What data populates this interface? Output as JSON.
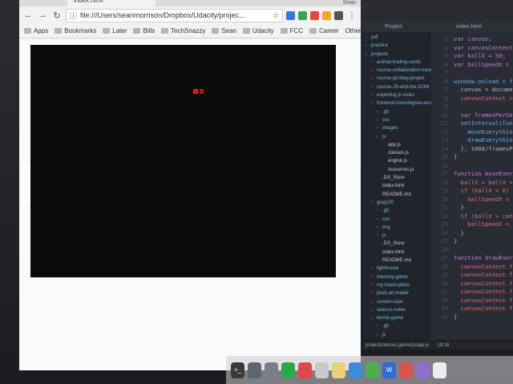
{
  "browser": {
    "tab_title": "index.html",
    "user": "Sean",
    "url": "file:///Users/seanmorrison/Dropbox/Udacity/projec...",
    "bookmarks": [
      "Apps",
      "Bookmarks",
      "Later",
      "Bills",
      "TechSnazzy",
      "Sean",
      "Udacity",
      "FCC",
      "Career"
    ],
    "other_bookmarks": "Other Bookmarks"
  },
  "editor": {
    "tab_title": "index.html",
    "panel_title": "Project",
    "tree": [
      {
        "label": "pdf",
        "indent": 0,
        "folder": true
      },
      {
        "label": "practice",
        "indent": 0,
        "folder": true
      },
      {
        "label": "projects",
        "indent": 0,
        "folder": true
      },
      {
        "label": "animal-trading-cards",
        "indent": 1,
        "folder": true
      },
      {
        "label": "course-collaboration-travel",
        "indent": 1,
        "folder": true
      },
      {
        "label": "course-git-blog-project",
        "indent": 1,
        "folder": true
      },
      {
        "label": "course-JS-and-the-DOM",
        "indent": 1,
        "folder": true
      },
      {
        "label": "exploring-js-notes",
        "indent": 1,
        "folder": true
      },
      {
        "label": "frontend-nanodegree-arcade",
        "indent": 1,
        "folder": true
      },
      {
        "label": ".git",
        "indent": 2,
        "folder": true
      },
      {
        "label": "css",
        "indent": 2,
        "folder": true
      },
      {
        "label": "images",
        "indent": 2,
        "folder": true
      },
      {
        "label": "js",
        "indent": 2,
        "folder": true
      },
      {
        "label": "app.js",
        "indent": 3,
        "folder": false
      },
      {
        "label": "classes.js",
        "indent": 3,
        "folder": false
      },
      {
        "label": "engine.js",
        "indent": 3,
        "folder": false
      },
      {
        "label": "resources.js",
        "indent": 3,
        "folder": false
      },
      {
        "label": ".DS_Store",
        "indent": 2,
        "folder": false
      },
      {
        "label": "index.html",
        "indent": 2,
        "folder": false
      },
      {
        "label": "README.md",
        "indent": 2,
        "folder": false
      },
      {
        "label": "gwg100",
        "indent": 1,
        "folder": true
      },
      {
        "label": ".git",
        "indent": 2,
        "folder": true
      },
      {
        "label": "css",
        "indent": 2,
        "folder": true
      },
      {
        "label": "img",
        "indent": 2,
        "folder": true
      },
      {
        "label": "js",
        "indent": 2,
        "folder": true
      },
      {
        "label": ".DS_Store",
        "indent": 2,
        "folder": false
      },
      {
        "label": "index.html",
        "indent": 2,
        "folder": false
      },
      {
        "label": "README.md",
        "indent": 2,
        "folder": false
      },
      {
        "label": "lighthouse",
        "indent": 1,
        "folder": true
      },
      {
        "label": "memory-game",
        "indent": 1,
        "folder": true
      },
      {
        "label": "my-travel-plans",
        "indent": 1,
        "folder": true
      },
      {
        "label": "pixel-art-maker",
        "indent": 1,
        "folder": true
      },
      {
        "label": "screen-caps",
        "indent": 1,
        "folder": true
      },
      {
        "label": "sean-js-notes",
        "indent": 1,
        "folder": true
      },
      {
        "label": "tennis-game",
        "indent": 1,
        "folder": true
      },
      {
        "label": ".git",
        "indent": 2,
        "folder": true
      },
      {
        "label": "js",
        "indent": 2,
        "folder": true
      },
      {
        "label": "app.js",
        "indent": 3,
        "folder": false
      }
    ],
    "code_lines": [
      "var canvas;",
      "var canvasContext;",
      "var ballX = 50;",
      "var ballSpeedX = 15;",
      "",
      "window.onload = functi",
      "  canvas = document.ge",
      "  canvasContext = canv",
      "",
      "  var framesPerSecond",
      "  setInterval(function",
      "    moveEverything();",
      "    drawEverything();",
      "  }, 1000/framesPerSeco",
      "}",
      "",
      "function moveEverything(",
      "  ballX = ballX + ballS",
      "  if (ballX < 0) {",
      "    ballSpeedX = -ballS",
      "  }",
      "  if (ballX > canvas.wid",
      "    ballSpeedX = -ballS",
      "  }",
      "}",
      "",
      "function drawEverything(",
      "  canvasContext.fillStyl",
      "  canvasContext.fillRect(",
      "  canvasContext.fillStyle",
      "  canvasContext.fillRect(",
      "  canvasContext.fillStyle",
      "  canvasContext.fillRect(",
      "}"
    ],
    "status_path": "projects/tennis-game/js/app.js",
    "status_cursor": "19:16"
  }
}
